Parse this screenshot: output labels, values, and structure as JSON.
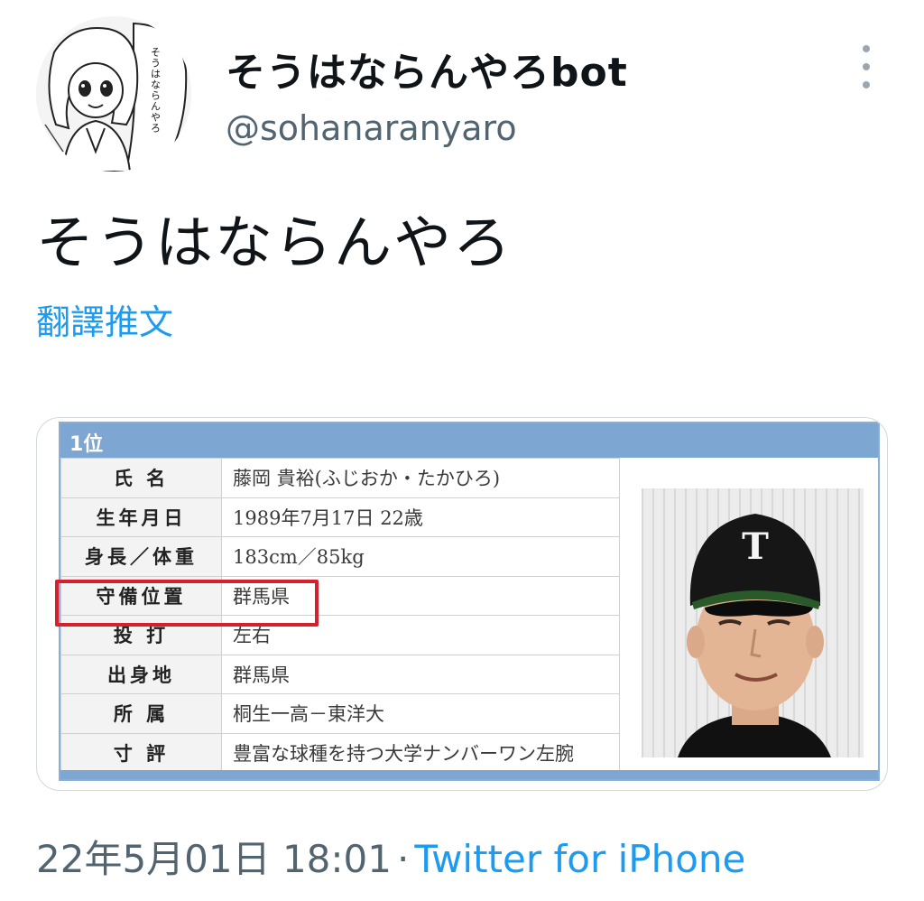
{
  "author": {
    "display_name": "そうはならんやろbot",
    "handle": "@sohanaranyaro",
    "avatar_icon": "manga-character-avatar",
    "avatar_bubble_text": "そうはならんやろ"
  },
  "more_menu": {
    "icon": "more-vertical-icon"
  },
  "tweet": {
    "text": "そうはならんやろ",
    "translate_label": "翻譯推文"
  },
  "card": {
    "rank_label": "1位",
    "rows": [
      {
        "key": "氏 名",
        "value": "藤岡 貴裕(ふじおか・たかひろ)"
      },
      {
        "key": "生年月日",
        "value": "1989年7月17日 22歳"
      },
      {
        "key": "身長／体重",
        "value": "183cm／85kg"
      },
      {
        "key": "守備位置",
        "value": "群馬県"
      },
      {
        "key": "投 打",
        "value": "左右"
      },
      {
        "key": "出身地",
        "value": "群馬県"
      },
      {
        "key": "所 属",
        "value": "桐生一高－東洋大"
      },
      {
        "key": "寸 評",
        "value": "豊富な球種を持つ大学ナンバーワン左腕"
      }
    ],
    "highlight_color": "#d81f2c",
    "header_color": "#7ea6d3",
    "photo_icon": "player-portrait"
  },
  "footer": {
    "timestamp": "22年5月01日 18:01",
    "separator": "·",
    "source": "Twitter for iPhone"
  },
  "colors": {
    "link": "#1d9bf0",
    "secondary_text": "#536471"
  }
}
